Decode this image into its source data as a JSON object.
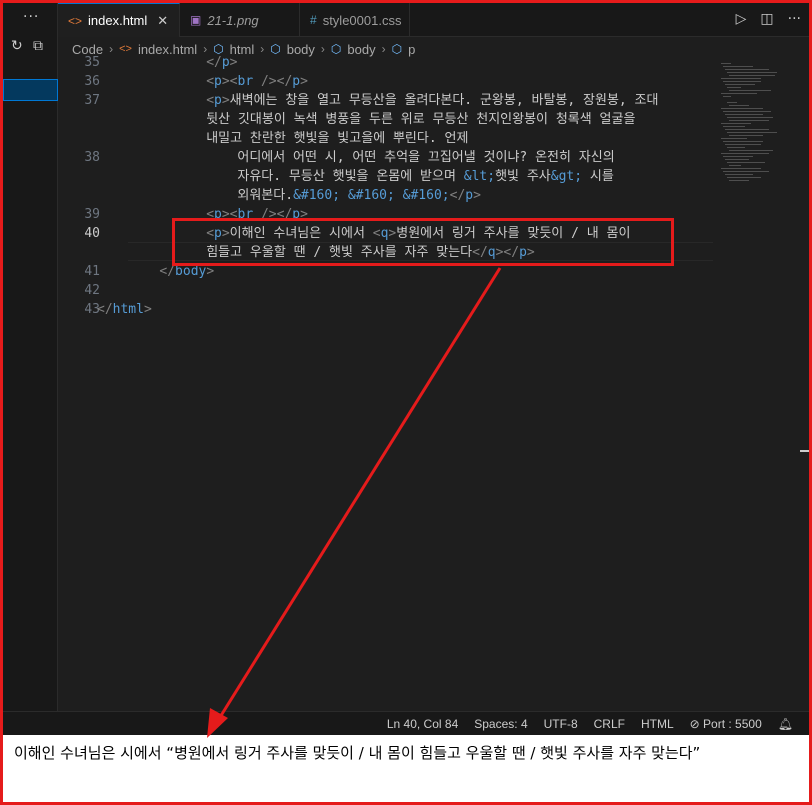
{
  "tabs": [
    {
      "icon": "<>",
      "label": "index.html",
      "close": "✕"
    },
    {
      "icon": "▣",
      "label": "21-1.png"
    },
    {
      "icon": "#",
      "label": "style0001.css"
    }
  ],
  "breadcrumb": [
    "Code",
    "index.html",
    "html",
    "body",
    "body",
    "p"
  ],
  "lines": [
    {
      "n": "35",
      "indent": 14,
      "parts": [
        [
          "t",
          "</"
        ],
        [
          "n",
          "p"
        ],
        [
          "t",
          ">"
        ]
      ]
    },
    {
      "n": "36",
      "indent": 14,
      "parts": [
        [
          "t",
          "<"
        ],
        [
          "n",
          "p"
        ],
        [
          "t",
          "><"
        ],
        [
          "n",
          "br"
        ],
        [
          "t",
          " />"
        ],
        [
          "t",
          "</"
        ],
        [
          "n",
          "p"
        ],
        [
          "t",
          ">"
        ]
      ]
    },
    {
      "n": "37",
      "indent": 14,
      "parts": [
        [
          "t",
          "<"
        ],
        [
          "n",
          "p"
        ],
        [
          "t",
          ">"
        ],
        [
          "c",
          "새벽에는 창을 열고 무등산을 올려다본다. 군왕봉, 바탈봉, 장원봉, 조대"
        ]
      ]
    },
    {
      "n": "",
      "indent": 14,
      "parts": [
        [
          "c",
          "뒷산 깃대봉이 녹색 병풍을 두른 위로 무등산 천지인왕봉이 청록색 얼굴을"
        ]
      ]
    },
    {
      "n": "",
      "indent": 14,
      "parts": [
        [
          "c",
          "내밀고 찬란한 햇빛을 빛고을에 뿌린다. 언제"
        ]
      ]
    },
    {
      "n": "38",
      "indent": 18,
      "parts": [
        [
          "c",
          "어디에서 어떤 시, 어떤 추억을 끄집어낼 것이냐? 온전히 자신의"
        ]
      ]
    },
    {
      "n": "",
      "indent": 18,
      "parts": [
        [
          "c",
          "자유다. 무등산 햇빛을 온몸에 받으며 "
        ],
        [
          "e",
          "&lt;"
        ],
        [
          "c",
          "햇빛 주사"
        ],
        [
          "e",
          "&gt;"
        ],
        [
          "c",
          " 시를"
        ]
      ]
    },
    {
      "n": "",
      "indent": 18,
      "parts": [
        [
          "c",
          "외워본다."
        ],
        [
          "e",
          "&#160;"
        ],
        [
          "c",
          " "
        ],
        [
          "e",
          "&#160;"
        ],
        [
          "c",
          " "
        ],
        [
          "e",
          "&#160;"
        ],
        [
          "t",
          "</"
        ],
        [
          "n",
          "p"
        ],
        [
          "t",
          ">"
        ]
      ]
    },
    {
      "n": "39",
      "indent": 14,
      "parts": [
        [
          "t",
          "<"
        ],
        [
          "n",
          "p"
        ],
        [
          "t",
          "><"
        ],
        [
          "n",
          "br"
        ],
        [
          "t",
          " /></"
        ],
        [
          "n",
          "p"
        ],
        [
          "t",
          ">"
        ]
      ]
    },
    {
      "n": "40",
      "indent": 14,
      "parts": [
        [
          "t",
          "<"
        ],
        [
          "n",
          "p"
        ],
        [
          "t",
          ">"
        ],
        [
          "c",
          "이해인 수녀님은 시에서 "
        ],
        [
          "t",
          "<"
        ],
        [
          "n",
          "q"
        ],
        [
          "t",
          ">"
        ],
        [
          "c",
          "병원에서 링거 주사를 맞듯이 / 내 몸이"
        ]
      ]
    },
    {
      "n": "",
      "indent": 14,
      "parts": [
        [
          "c",
          "힘들고 우울할 땐 / 햇빛 주사를 자주 맞는다"
        ],
        [
          "t",
          "</"
        ],
        [
          "n",
          "q"
        ],
        [
          "t",
          "></"
        ],
        [
          "n",
          "p"
        ],
        [
          "t",
          ">"
        ]
      ]
    },
    {
      "n": "41",
      "indent": 8,
      "parts": [
        [
          "t",
          "</"
        ],
        [
          "n",
          "body"
        ],
        [
          "t",
          ">"
        ]
      ]
    },
    {
      "n": "42",
      "indent": 0,
      "parts": []
    },
    {
      "n": "43",
      "indent": 0,
      "parts": [
        [
          "t",
          "</"
        ],
        [
          "n",
          "html"
        ],
        [
          "t",
          ">"
        ]
      ]
    }
  ],
  "status": {
    "position": "Ln 40, Col 84",
    "spaces": "Spaces: 4",
    "encoding": "UTF-8",
    "eol": "CRLF",
    "language": "HTML",
    "port": "Port : 5500"
  },
  "caption": "이해인 수녀님은 시에서 “병원에서 링거 주사를 맞듯이 / 내 몸이 힘들고 우울할 땐 / 햇빛 주사를 자주 맞는다”",
  "colors": {
    "annotation": "#e51b1b",
    "tag_name": "#569cd6",
    "punct": "#808080",
    "text": "#cccccc"
  }
}
